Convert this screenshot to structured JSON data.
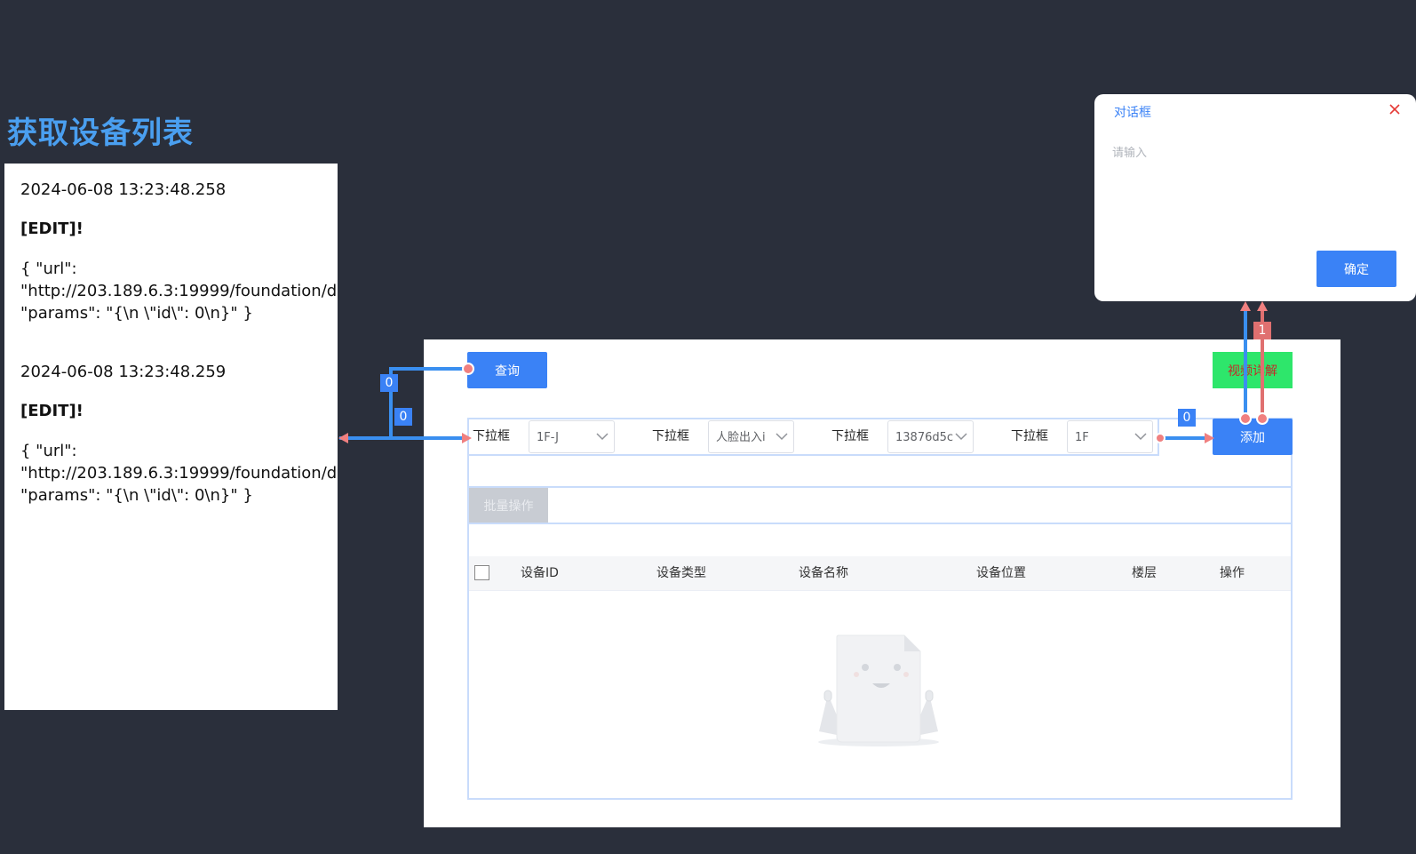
{
  "page": {
    "title": "获取设备列表"
  },
  "log": {
    "entries": [
      {
        "timestamp": "2024-06-08 13:23:48.258",
        "tag": "[EDIT]!",
        "body": "{ \"url\":\n\"http://203.189.6.3:19999/foundation/d\n\"params\": \"{\\n \\\"id\\\": 0\\n}\" }"
      },
      {
        "timestamp": "2024-06-08 13:23:48.259",
        "tag": "[EDIT]!",
        "body": "{ \"url\":\n\"http://203.189.6.3:19999/foundation/d\n\"params\": \"{\\n \\\"id\\\": 0\\n}\" }"
      }
    ]
  },
  "canvas": {
    "query_button": "查询",
    "video_button": "视频详解",
    "add_button": "添加",
    "batch_button": "批量操作",
    "filters": [
      {
        "label": "下拉框",
        "value": "1F-J"
      },
      {
        "label": "下拉框",
        "value": "人脸出入i"
      },
      {
        "label": "下拉框",
        "value": "13876d5c"
      },
      {
        "label": "下拉框",
        "value": "1F"
      }
    ],
    "table": {
      "columns": [
        "设备ID",
        "设备类型",
        "设备名称",
        "设备位置",
        "楼层",
        "操作"
      ]
    }
  },
  "dialog": {
    "title": "对话框",
    "input_placeholder": "请输入",
    "confirm_button": "确定"
  },
  "connectors": {
    "badges": [
      "0",
      "0",
      "0",
      "1"
    ]
  },
  "colors": {
    "background": "#2a2f3b",
    "accent": "#3a82f6",
    "title": "#4a9ff0",
    "video_button": "#2ee66b",
    "wire_blue": "#3a8ff0",
    "wire_red": "#e07070"
  },
  "icons": {
    "close": "close-icon",
    "chevron": "chevron-down-icon",
    "empty": "empty-document-icon"
  }
}
